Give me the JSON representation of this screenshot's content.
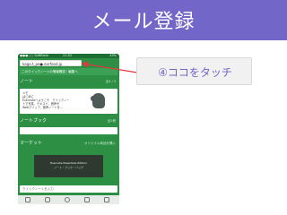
{
  "slide": {
    "title": "メール登録",
    "callout": "④ココをタッチ",
    "colors": {
      "header": "#7266c8",
      "app_green": "#2c8f43",
      "arrow": "#e0383b"
    }
  },
  "phone": {
    "status_left": "●●●○○ SoftBank",
    "status_time": "21:52",
    "status_right": "45%",
    "address": "kago.t_pe●.evrfood.jp",
    "banner": "このクイックノートの情報確認・編集へ",
    "notes_label": "ノート",
    "notes_count": "全9 / 3",
    "note_lines": [
      "メモ",
      "はじめに",
      "Evernoteへようこそ　クイックノー",
      "トで写真、テキスト、音声や",
      "Webクリップ、音声ノートを..."
    ],
    "notebook_label": "ノートブック",
    "notebook_count": "全2冊",
    "market_label": "マーケット",
    "market_note": "オリジナル商品を購入",
    "market_line1": "Evernote Essentials Edition",
    "market_line2": "ノート・ブック・バッグ",
    "quicknote_placeholder": "クイックノートを入力",
    "bottom_icons": [
      "camera-icon",
      "photo-icon",
      "audio-icon",
      "list-icon",
      "attach-icon"
    ]
  }
}
